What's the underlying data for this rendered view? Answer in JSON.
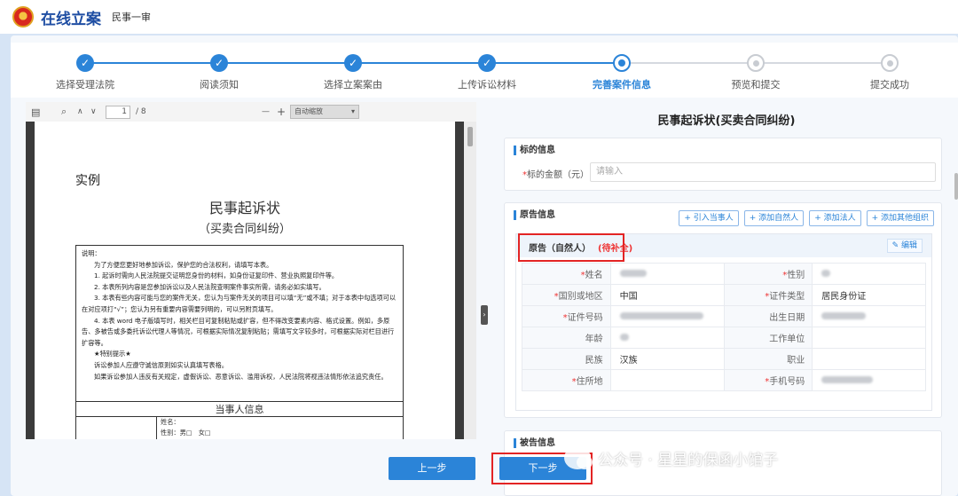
{
  "header": {
    "title": "在线立案",
    "subtitle": "民事一审"
  },
  "steps": [
    {
      "label": "选择受理法院",
      "state": "done"
    },
    {
      "label": "阅读须知",
      "state": "done"
    },
    {
      "label": "选择立案案由",
      "state": "done"
    },
    {
      "label": "上传诉讼材料",
      "state": "done"
    },
    {
      "label": "完善案件信息",
      "state": "active"
    },
    {
      "label": "预览和提交",
      "state": "todo"
    },
    {
      "label": "提交成功",
      "state": "todo"
    }
  ],
  "viewer": {
    "page": "1",
    "page_total": "/ 8",
    "zoom": "自动缩放",
    "zoom_caret": "▾",
    "sidebar_icon": "sidebar-toggle-icon",
    "minus": "—",
    "plus": "+",
    "up": "∧",
    "down": "∨"
  },
  "doc": {
    "example": "实例",
    "title": "民事起诉状",
    "subtitle": "（买卖合同纠纷）",
    "notes_title": "说明：",
    "notes": [
      "为了方便您更好地参加诉讼，保护您的合法权利，请填写本表。",
      "1. 起诉时需向人民法院提交证明您身份的材料，如身份证复印件、营业执照复印件等。",
      "2. 本表所列内容是您参加诉讼以及人民法院查明案件事实所需，请务必如实填写。",
      "3. 本表有些内容可能与您的案件无关，您认为与案件无关的项目可以填“无”或不填；对于本表中勾选项可以在对应项打“√”；您认为另有重要内容需要列明的，可以另附页填写。",
      "4. 本表 word 电子版填写时，相关栏目可复制粘贴或扩容，但不得改变要素内容、格式设置。例如，多原告、多被告或多委托诉讼代理人等情况，可根据实际情况复制粘贴；需填写文字较多时，可根据实际对栏目进行扩容等。",
      "★特别提示★",
      "诉讼参加人应遵守诚信原则如实认真填写表格。",
      "如果诉讼参加人违反有关规定，虚假诉讼、恶意诉讼、滥用诉权，人民法院将视违法情形依法追究责任。"
    ],
    "party_header": "当事人信息",
    "party_name": "姓名：",
    "party_gender": "性别：男□　女□"
  },
  "form": {
    "title": "民事起诉状(买卖合同纠纷)",
    "subject": {
      "heading": "标的信息",
      "amount_label": "标的金额（元）",
      "amount_placeholder": "请输入"
    },
    "plaintiff": {
      "heading": "原告信息",
      "buttons": [
        "+ 引入当事人",
        "+ 添加自然人",
        "+ 添加法人",
        "+ 添加其他组织"
      ],
      "person_label": "原告（自然人）",
      "pending": "(待补全)",
      "edit": "编辑",
      "fields": {
        "name": "姓名",
        "gender": "性别",
        "nationality": "国别或地区",
        "nationality_value": "中国",
        "id_type": "证件类型",
        "id_type_value": "居民身份证",
        "id_number": "证件号码",
        "birth": "出生日期",
        "age": "年龄",
        "employer": "工作单位",
        "ethnic": "民族",
        "ethnic_value": "汉族",
        "job": "职业",
        "address": "住所地",
        "phone": "手机号码"
      }
    },
    "defendant_heading": "被告信息"
  },
  "buttons": {
    "prev": "上一步",
    "next": "下一步"
  },
  "watermark": "公众号 · 星星的保函小馆子",
  "colors": {
    "primary": "#2b84d8",
    "highlight": "#e32424"
  }
}
